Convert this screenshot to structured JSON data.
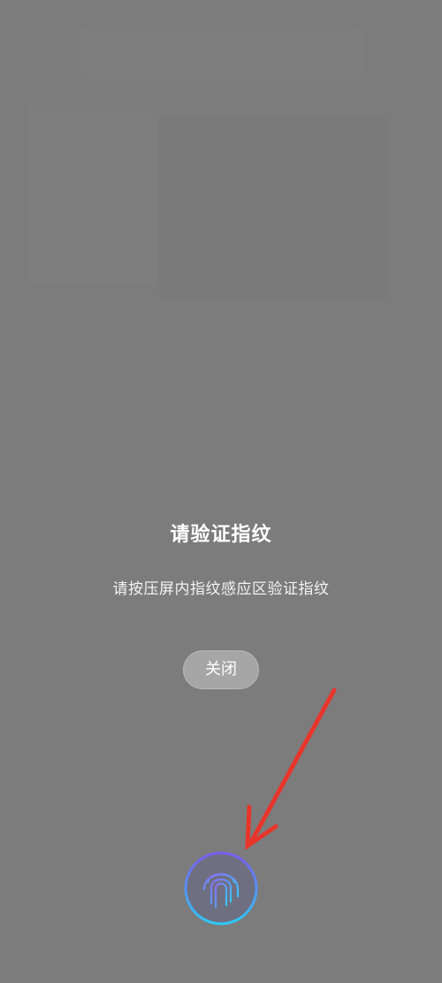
{
  "dialog": {
    "title": "请验证指纹",
    "subtitle": "请按压屏内指纹感应区验证指纹",
    "close_label": "关闭"
  },
  "fingerprint": {
    "icon": "fingerprint-icon"
  },
  "annotation": {
    "icon": "red-arrow-icon",
    "color": "#e8352c"
  },
  "colors": {
    "overlay": "#7c7c7c",
    "ring_start": "#7b5cf0",
    "ring_end": "#2ec9f5"
  }
}
